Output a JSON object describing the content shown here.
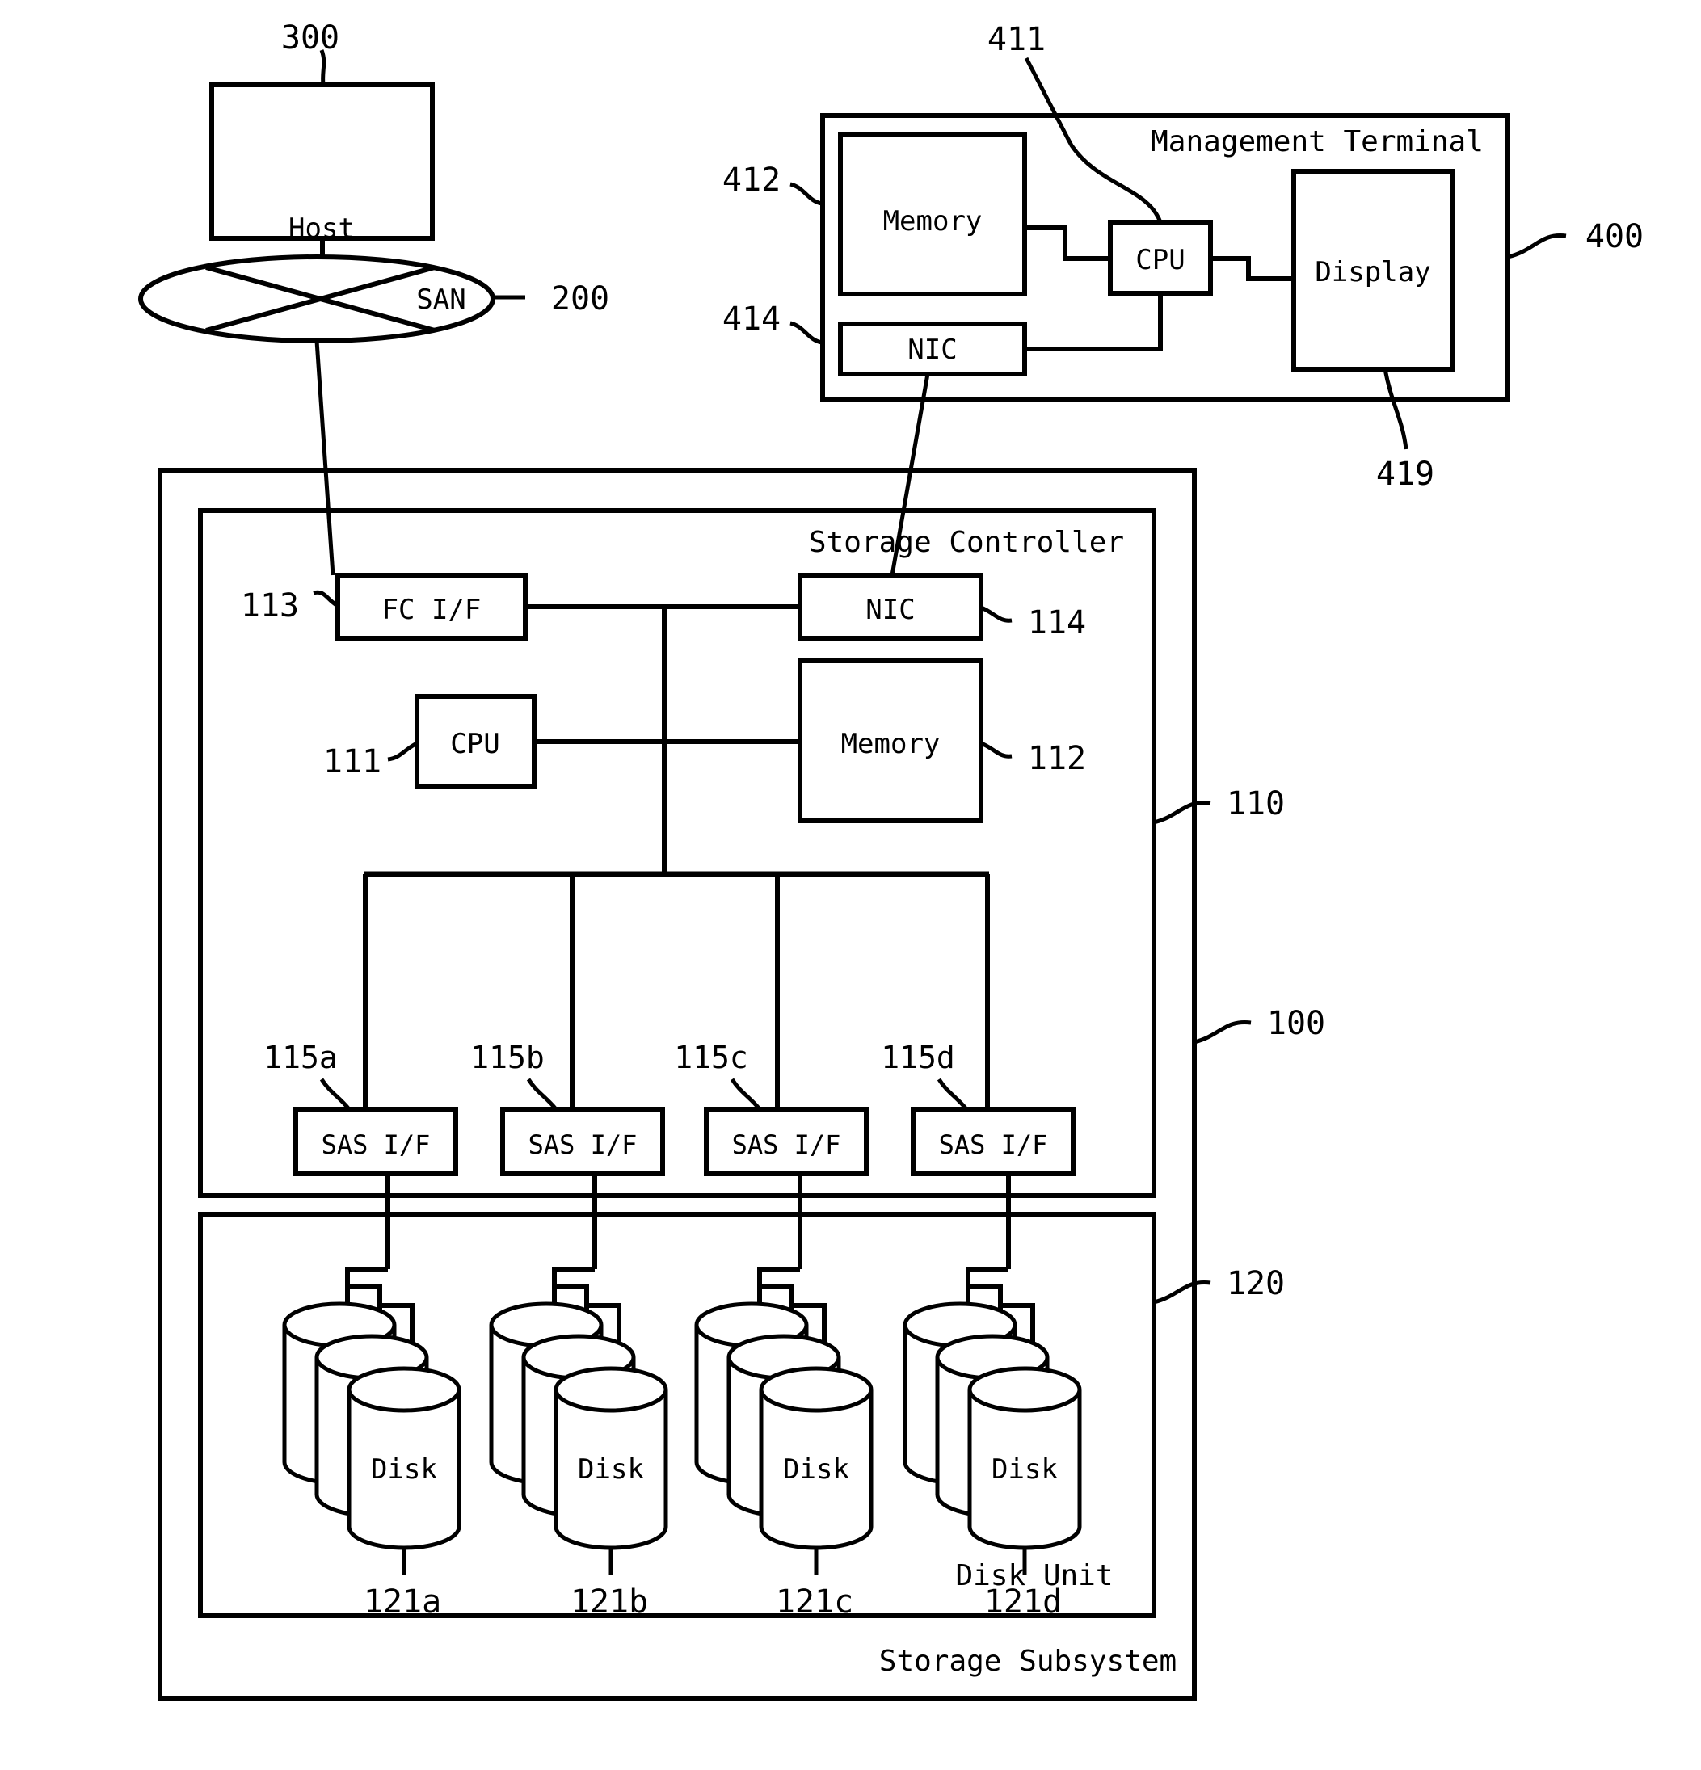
{
  "figure": {
    "type": "system-block-diagram",
    "background": "#ffffff",
    "stroke": "#000000"
  },
  "host": {
    "label": "Host",
    "ref": "300"
  },
  "network": {
    "label": "SAN",
    "ref": "200"
  },
  "management_terminal": {
    "title": "Management Terminal",
    "ref": "400",
    "memory": {
      "label": "Memory",
      "ref": "412"
    },
    "nic": {
      "label": "NIC",
      "ref": "414"
    },
    "cpu": {
      "label": "CPU",
      "ref": "411"
    },
    "display": {
      "label": "Display",
      "ref": "419"
    }
  },
  "storage_subsystem": {
    "title": "Storage Subsystem",
    "ref": "100",
    "controller": {
      "title": "Storage Controller",
      "ref": "110",
      "fc_if": {
        "label": "FC I/F",
        "ref": "113"
      },
      "nic": {
        "label": "NIC",
        "ref": "114"
      },
      "cpu": {
        "label": "CPU",
        "ref": "111"
      },
      "memory": {
        "label": "Memory",
        "ref": "112"
      },
      "sas_interfaces": [
        {
          "label": "SAS I/F",
          "ref": "115a"
        },
        {
          "label": "SAS I/F",
          "ref": "115b"
        },
        {
          "label": "SAS I/F",
          "ref": "115c"
        },
        {
          "label": "SAS I/F",
          "ref": "115d"
        }
      ]
    },
    "disk_unit": {
      "title": "Disk Unit",
      "ref": "120",
      "disk_groups": [
        {
          "label": "Disk",
          "ref": "121a"
        },
        {
          "label": "Disk",
          "ref": "121b"
        },
        {
          "label": "Disk",
          "ref": "121c"
        },
        {
          "label": "Disk",
          "ref": "121d"
        }
      ]
    }
  }
}
